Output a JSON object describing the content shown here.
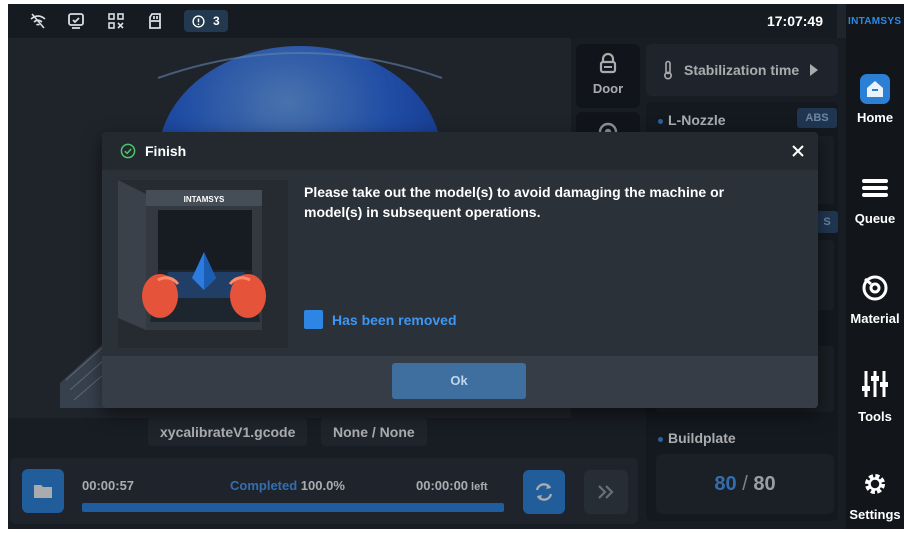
{
  "status_bar": {
    "icons": [
      "wifi-off-icon",
      "monitor-check-icon",
      "qr-code-icon",
      "sd-card-icon"
    ],
    "alert_icon": "alert-circle-icon",
    "alert_count": "3",
    "time": "17:07:49"
  },
  "brand": "INTAMSYS",
  "nav": {
    "items": [
      {
        "label": "Home",
        "icon": "home-icon",
        "active": true
      },
      {
        "label": "Queue",
        "icon": "queue-icon"
      },
      {
        "label": "Material",
        "icon": "material-spool-icon"
      },
      {
        "label": "Tools",
        "icon": "tools-sliders-icon"
      },
      {
        "label": "Settings",
        "icon": "gear-icon"
      }
    ]
  },
  "controls": {
    "door_label": "Door",
    "stabilization_label": "Stabilization time"
  },
  "panel": {
    "nozzle_title": "L-Nozzle",
    "nozzle_badge": "ABS",
    "second_badge": "S",
    "buildplate_title": "Buildplate",
    "buildplate_current": "80",
    "buildplate_separator": "/",
    "buildplate_target": "80"
  },
  "file": {
    "name": "xycalibrateV1.gcode",
    "material": "None / None"
  },
  "progress": {
    "elapsed": "00:00:57",
    "status_label": "Completed",
    "percent_text": "100.0%",
    "percent": 100,
    "remaining": "00:00:00",
    "remaining_suffix": "left"
  },
  "dialog": {
    "title": "Finish",
    "message": "Please take out the model(s) to avoid damaging the machine or model(s) in subsequent operations.",
    "image_brand": "INTAMSYS",
    "checkbox_label": "Has been removed",
    "checkbox_checked": true,
    "ok_label": "Ok"
  },
  "colors": {
    "accent": "#2d86e4",
    "accent_text": "#3d97f5",
    "background": "#1f252d"
  }
}
